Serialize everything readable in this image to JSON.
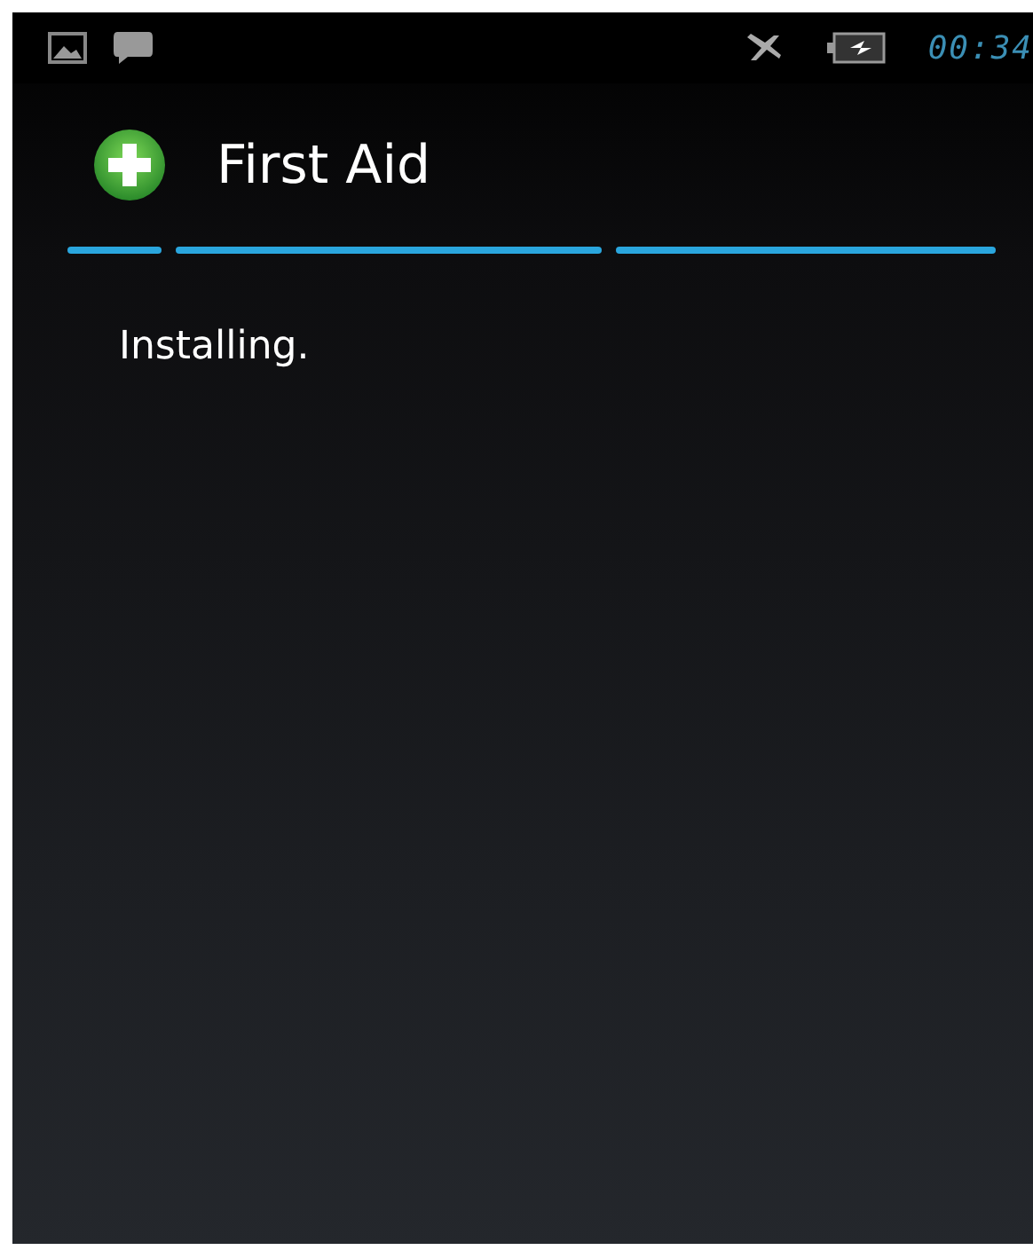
{
  "status_bar": {
    "time": "00:34"
  },
  "title_bar": {
    "title": "First Aid"
  },
  "content": {
    "message": "Installing."
  }
}
